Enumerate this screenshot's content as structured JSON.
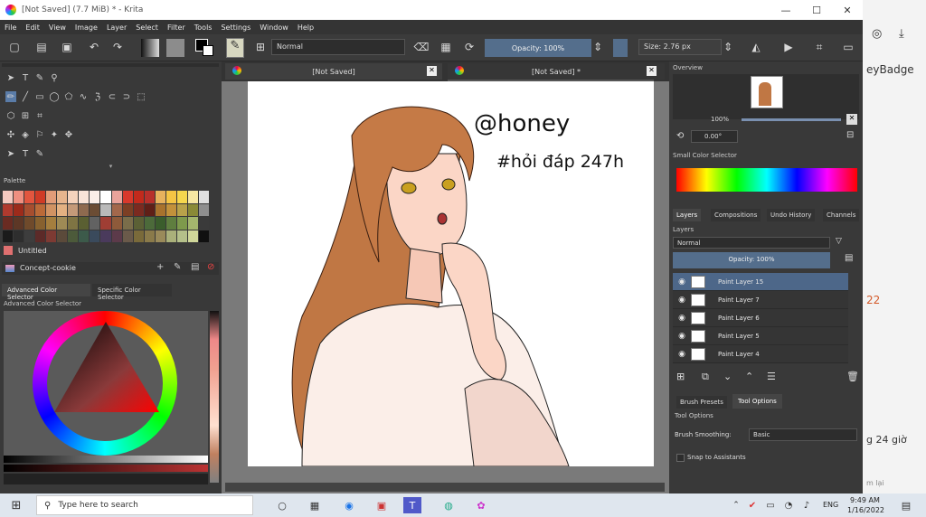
{
  "window": {
    "title": "[Not Saved]  (7.7 MiB)  * - Krita",
    "minimize": "—",
    "maximize": "☐",
    "close": "✕"
  },
  "menu": [
    "File",
    "Edit",
    "View",
    "Image",
    "Layer",
    "Select",
    "Filter",
    "Tools",
    "Settings",
    "Window",
    "Help"
  ],
  "toolbar": {
    "blend_mode": "Normal",
    "opacity": "Opacity: 100%",
    "size": "Size: 2.76 px"
  },
  "left_dock": {
    "palette_title": "Palette",
    "palette_name": "Untitled",
    "brush_preset": "Concept-cookie",
    "tabs": [
      "Advanced Color Selector",
      "Specific Color Selector"
    ],
    "adv_title": "Advanced Color Selector"
  },
  "palette_colors": [
    "#f4c9c0",
    "#ef8f80",
    "#e2563f",
    "#cf3b26",
    "#e29c78",
    "#e7b58d",
    "#f5d3bc",
    "#f9e4d8",
    "#fbeee8",
    "#ffffff",
    "#e9a39b",
    "#d8392c",
    "#c22a1c",
    "#b8302b",
    "#e7b25d",
    "#f4c544",
    "#f6d74d",
    "#f7e7a2",
    "#e0e0e0",
    "#b03a2e",
    "#9c2b1b",
    "#a64e2f",
    "#bb6a38",
    "#d19363",
    "#e3b182",
    "#c49a79",
    "#8e6a4f",
    "#6b4c34",
    "#b9b9b9",
    "#a2674b",
    "#7c3f24",
    "#7b2a20",
    "#5f1f17",
    "#a8722d",
    "#c2913b",
    "#b8a24a",
    "#8a8a37",
    "#8f8f8f",
    "#6a2b22",
    "#5d3726",
    "#6f4a2b",
    "#87612f",
    "#a47e3e",
    "#9e8a55",
    "#7f7443",
    "#5a5f32",
    "#626262",
    "#9f3e34",
    "#8e5a3a",
    "#7a6d4a",
    "#5b6035",
    "#4c6a3a",
    "#3b5d2c",
    "#5f7e3f",
    "#7e9a4c",
    "#a4b66d",
    "#3a3a3a",
    "#1b1b1b",
    "#2e2e2e",
    "#3d3d3d",
    "#5c2a28",
    "#7d3a33",
    "#5b4a3a",
    "#4c5a3a",
    "#3c5a4a",
    "#3a4a5c",
    "#4a3a5c",
    "#5c3a4a",
    "#6a5a4a",
    "#7a6a3a",
    "#8a7a4a",
    "#9a8a5a",
    "#aab07a",
    "#b5c08a",
    "#d0d79a",
    "#101010"
  ],
  "tool_glyphs": [
    "➤",
    "T",
    "✎",
    "⚲",
    "✏",
    "╱",
    "▭",
    "◯",
    "⬠",
    "∿",
    "ℨ",
    "⊂",
    "⊃",
    "⬚",
    "⬡",
    "⊞",
    "⌗",
    "✣",
    "◈",
    "⚐",
    "✦",
    "✥"
  ],
  "canvas": {
    "tab1": "[Not Saved]",
    "tab2": "[Not Saved]  *",
    "handwriting_1": "@honey",
    "handwriting_2": "#hỏi đáp 247h"
  },
  "right_dock": {
    "overview_title": "Overview",
    "zoom": "100%",
    "rotation": "0.00°",
    "small_color_title": "Small Color Selector",
    "tabs": [
      "Layers",
      "Compositions",
      "Undo History",
      "Channels"
    ],
    "layers_title": "Layers",
    "layer_mode": "Normal",
    "layer_opacity": "Opacity: 100%",
    "layers": [
      "Paint Layer 15",
      "Paint Layer 7",
      "Paint Layer 6",
      "Paint Layer 5",
      "Paint Layer 4"
    ],
    "bottom_tabs": [
      "Brush Presets",
      "Tool Options"
    ],
    "tool_options_title": "Tool Options",
    "brush_smoothing_label": "Brush Smoothing:",
    "brush_smoothing_value": "Basic",
    "snap_label": "Snap to Assistants"
  },
  "background_page": {
    "label1": "eyBadge",
    "label2": "22",
    "label3": "g 24 giờ",
    "label4": "m lại"
  },
  "taskbar": {
    "search_placeholder": "Type here to search",
    "time": "9:49 AM",
    "date": "1/16/2022",
    "lang": "ENG"
  }
}
